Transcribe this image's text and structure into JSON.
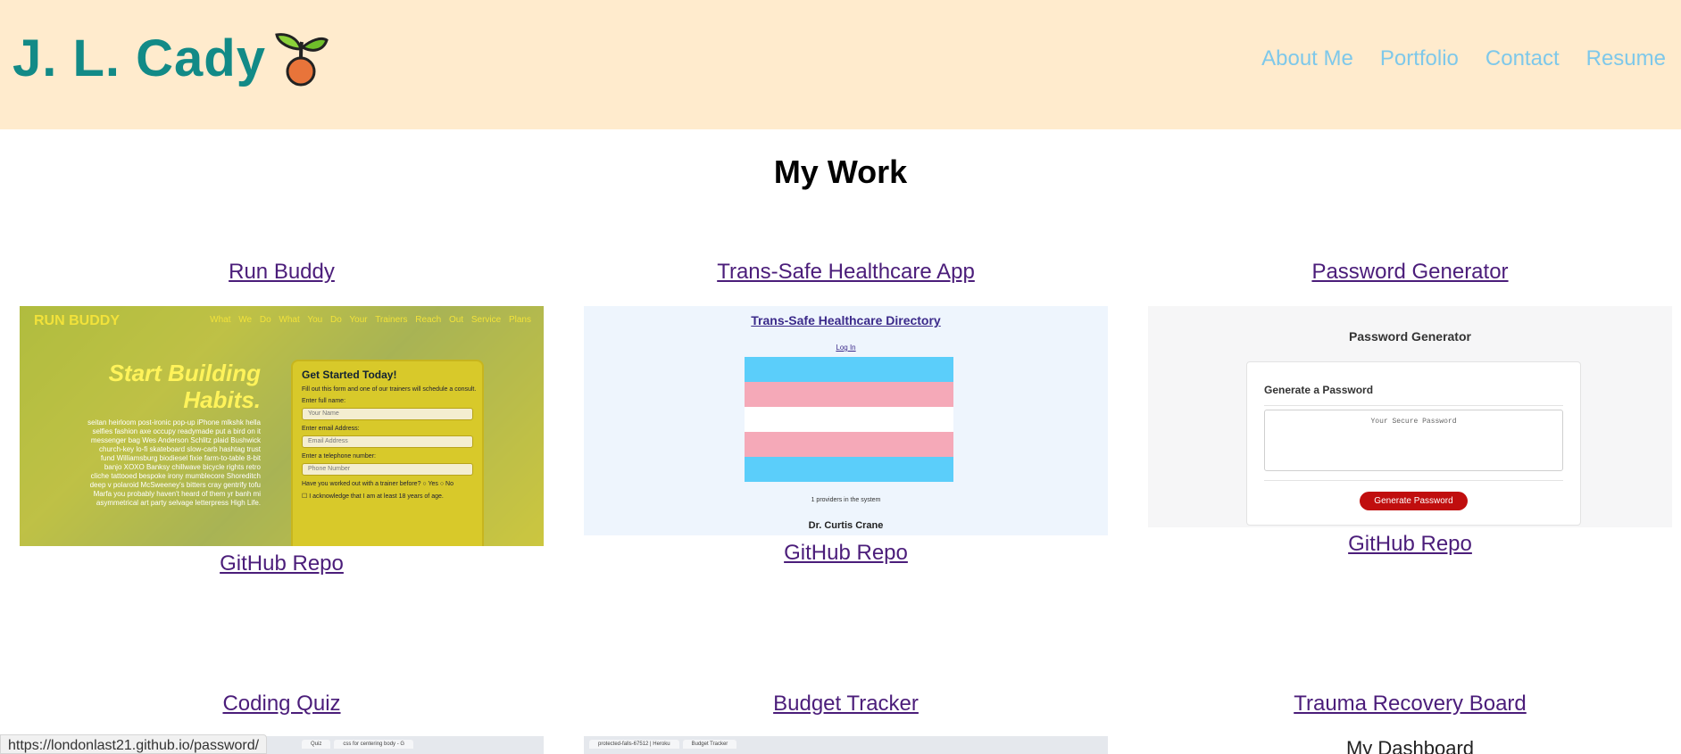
{
  "header": {
    "brand": "J. L. Cady",
    "nav": [
      "About Me",
      "Portfolio",
      "Contact",
      "Resume"
    ]
  },
  "section_title": "My Work",
  "projects": [
    {
      "title": "Run Buddy",
      "repo": "GitHub Repo"
    },
    {
      "title": "Trans-Safe Healthcare App",
      "repo": "GitHub Repo"
    },
    {
      "title": "Password Generator",
      "repo": "GitHub Repo"
    },
    {
      "title": "Coding Quiz"
    },
    {
      "title": "Budget Tracker"
    },
    {
      "title": "Trauma Recovery Board"
    }
  ],
  "run_buddy_shot": {
    "logo": "RUN BUDDY",
    "nav": "What We Do What You Do Your Trainers Reach Out Service Plans",
    "hero": "Start Building Habits.",
    "blurb": "seitan heirloom post-ironic pop-up iPhone mlkshk hella selfies fashion axe occupy readymade put a bird on it messenger bag Wes Anderson Schlitz plaid Bushwick church-key lo-fi skateboard slow-carb hashtag trust fund Williamsburg biodiesel fixie farm-to-table 8-bit banjo XOXO Banksy chillwave bicycle rights retro cliche tattooed bespoke irony mumblecore Shoreditch deep v polaroid McSweeney's bitters cray gentrify tofu Marfa you probably haven't heard of them yr banh mi asymmetrical art party selvage letterpress High Life.",
    "form_title": "Get Started Today!",
    "form_intro": "Fill out this form and one of our trainers will schedule a consult.",
    "label_name": "Enter full name:",
    "ph_name": "Your Name",
    "label_email": "Enter email Address:",
    "ph_email": "Email Address",
    "label_phone": "Enter a telephone number:",
    "ph_phone": "Phone Number",
    "question": "Have you worked out with a trainer before?",
    "yes": "Yes",
    "no": "No",
    "ack": "I acknowledge that I am at least 18 years of age."
  },
  "trans_safe_shot": {
    "title": "Trans-Safe Healthcare Directory",
    "login": "Log In",
    "count": "1 providers in the system",
    "doctor": "Dr. Curtis Crane",
    "flag_colors": [
      "#5bcefa",
      "#f5a9b8",
      "#ffffff",
      "#f5a9b8",
      "#5bcefa"
    ]
  },
  "password_shot": {
    "title": "Password Generator",
    "card_title": "Generate a Password",
    "placeholder": "Your Secure Password",
    "button": "Generate Password"
  },
  "quiz_shot_tabs": [
    "Quiz",
    "css for centering body - G"
  ],
  "budget_shot_tabs": [
    "protected-falls-67512 | Heroku",
    "Budget Tracker"
  ],
  "trauma_shot": {
    "heading": "My Dashboard"
  },
  "status_bar": {
    "url": "https://londonlast21.github.io/password/"
  }
}
